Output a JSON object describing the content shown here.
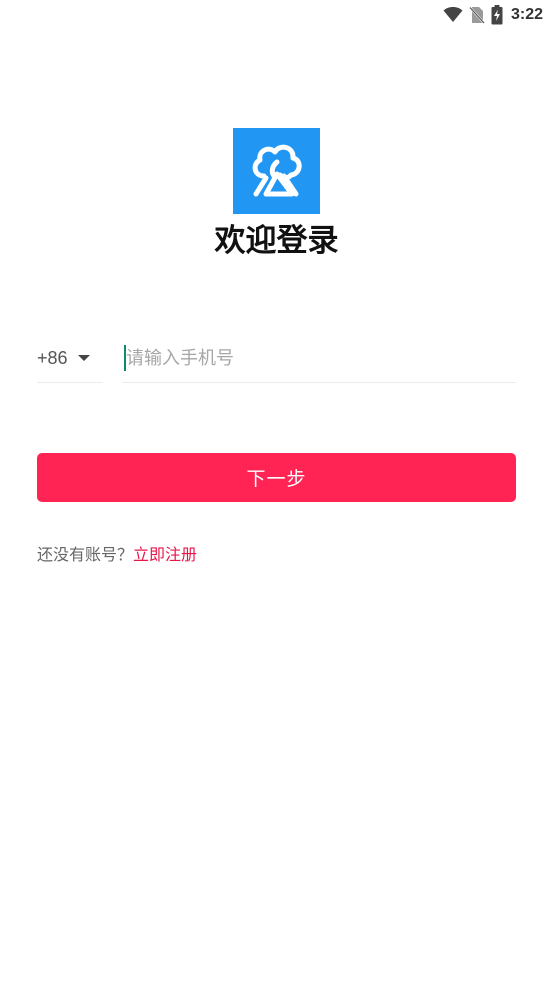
{
  "status_bar": {
    "time": "3:22",
    "icons": [
      "wifi-icon",
      "no-sim-icon",
      "battery-charging-icon"
    ]
  },
  "brand": {
    "logo_icon": "tree-logo-icon",
    "logo_color": "#2196F3"
  },
  "login": {
    "title": "欢迎登录",
    "country_code": "+86",
    "phone_placeholder": "请输入手机号",
    "phone_value": "",
    "next_label": "下一步",
    "no_account_prompt": "还没有账号？",
    "register_label": "立即注册"
  },
  "colors": {
    "accent": "#FF2453",
    "link": "#E8174A",
    "cursor": "#0f8a6e"
  }
}
